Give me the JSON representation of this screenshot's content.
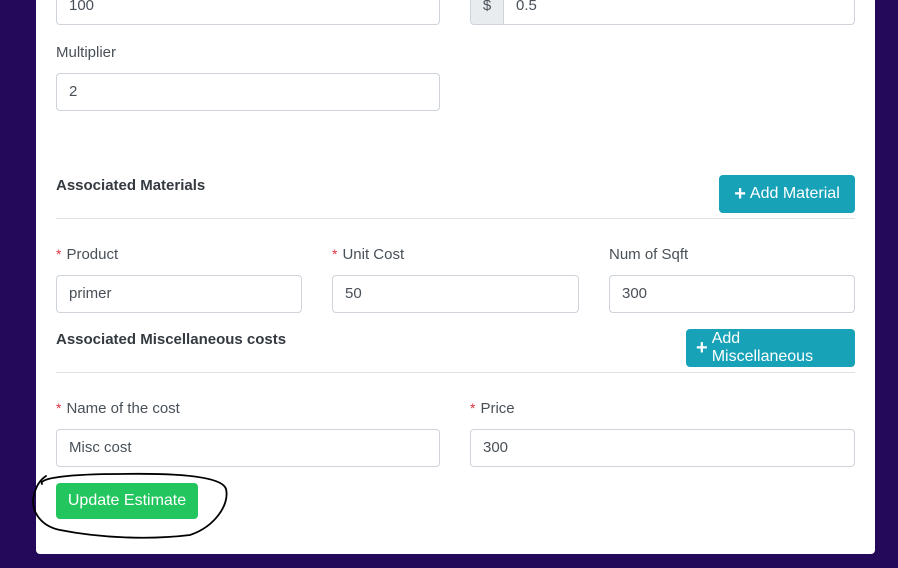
{
  "top_row": {
    "left_value": "100",
    "currency_symbol": "$",
    "right_value": "0.5"
  },
  "multiplier": {
    "label": "Multiplier",
    "value": "2"
  },
  "materials": {
    "title": "Associated Materials",
    "add_button": "Add Material",
    "product_label": "Product",
    "product_value": "primer",
    "unit_cost_label": "Unit Cost",
    "unit_cost_value": "50",
    "sqft_label": "Num of Sqft",
    "sqft_value": "300"
  },
  "misc": {
    "title": "Associated Miscellaneous costs",
    "add_button": "Add Miscellaneous",
    "name_label": "Name of the cost",
    "name_value": "Misc cost",
    "price_label": "Price",
    "price_value": "300"
  },
  "update_button": "Update Estimate",
  "required_marker": "*",
  "add_icon": "plus-icon",
  "colors": {
    "background": "#24085a",
    "info": "#17a2b8",
    "success": "#22c55e",
    "required": "#dc3545"
  }
}
